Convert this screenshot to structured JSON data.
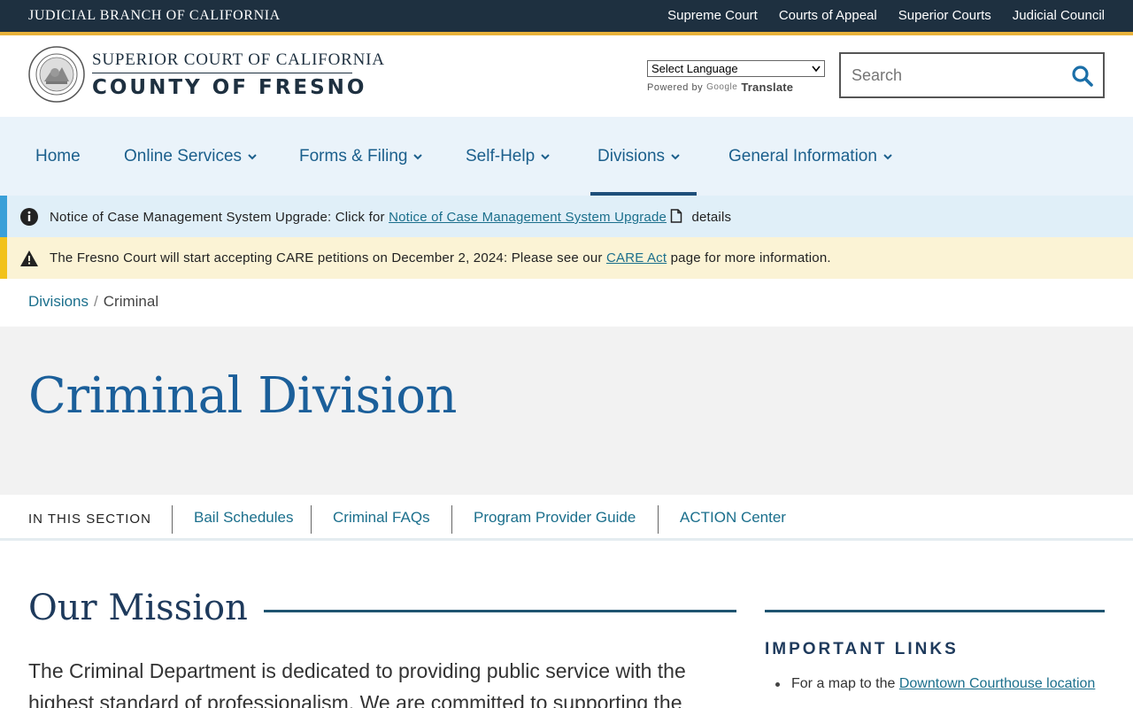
{
  "topbar": {
    "brand": "JUDICIAL BRANCH OF CALIFORNIA",
    "links": [
      "Supreme Court",
      "Courts of Appeal",
      "Superior Courts",
      "Judicial Council"
    ]
  },
  "header": {
    "court_line1": "SUPERIOR COURT OF CALIFORNIA",
    "court_line2": "COUNTY OF FRESNO",
    "language_select": "Select Language",
    "powered_by": "Powered by",
    "google": "Google",
    "translate": "Translate",
    "search_placeholder": "Search"
  },
  "nav": {
    "items": [
      {
        "label": "Home"
      },
      {
        "label": "Online Services"
      },
      {
        "label": "Forms & Filing"
      },
      {
        "label": "Self-Help"
      },
      {
        "label": "Divisions"
      },
      {
        "label": "General Information"
      }
    ]
  },
  "alerts": {
    "info": {
      "prefix": "Notice of Case Management System Upgrade: Click for",
      "link": "Notice of Case Management System Upgrade",
      "suffix": "details"
    },
    "warning": {
      "prefix": "The Fresno Court will start accepting CARE petitions on December 2, 2024: Please see our",
      "link": "CARE Act",
      "suffix": "page for more information."
    }
  },
  "breadcrumb": {
    "parent": "Divisions",
    "separator": "/",
    "current": "Criminal"
  },
  "hero": {
    "title": "Criminal Division"
  },
  "section_nav": {
    "label": "IN THIS SECTION",
    "items": [
      "Bail Schedules",
      "Criminal FAQs",
      "Program Provider Guide",
      "ACTION Center"
    ]
  },
  "mission": {
    "title": "Our Mission",
    "text": "The Criminal Department is dedicated to providing public service with the highest standard of professionalism. We are committed to supporting the"
  },
  "sidebar": {
    "title": "IMPORTANT LINKS",
    "item1_prefix": "For a map to the",
    "item1_link": "Downtown Courthouse location"
  },
  "colors": {
    "topbar": "#1e3040",
    "gold": "#e8b23a",
    "link": "#1b6f8c",
    "nav_bg": "#eaf3fa",
    "info_bar": "#3aa0d8",
    "warn_bar": "#f2c21a"
  }
}
